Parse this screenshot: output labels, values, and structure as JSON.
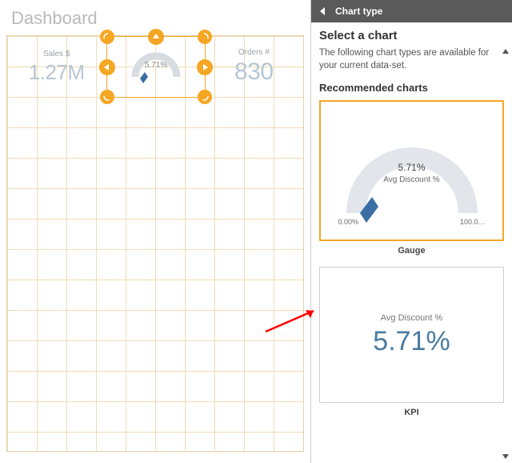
{
  "dashboard": {
    "title": "Dashboard",
    "tiles": {
      "sales": {
        "label": "Sales $",
        "value": "1.27M"
      },
      "gauge": {
        "value": "5.71%"
      },
      "orders": {
        "label": "Orders #",
        "value": "830"
      }
    }
  },
  "panel": {
    "header": "Chart type",
    "heading": "Select a chart",
    "description": "The following chart types are available for your current data-set.",
    "section": "Recommended charts",
    "gauge_card": {
      "value": "5.71%",
      "subtitle": "Avg Discount %",
      "min": "0.00%",
      "max": "100.0…",
      "caption": "Gauge"
    },
    "kpi_card": {
      "label": "Avg Discount %",
      "value": "5.71%",
      "caption": "KPI"
    }
  },
  "chart_data": {
    "type": "bar",
    "title": "Avg Discount % gauge",
    "categories": [
      "Avg Discount %"
    ],
    "values": [
      5.71
    ],
    "ylim": [
      0,
      100
    ],
    "ylabel": "%",
    "xlabel": ""
  }
}
